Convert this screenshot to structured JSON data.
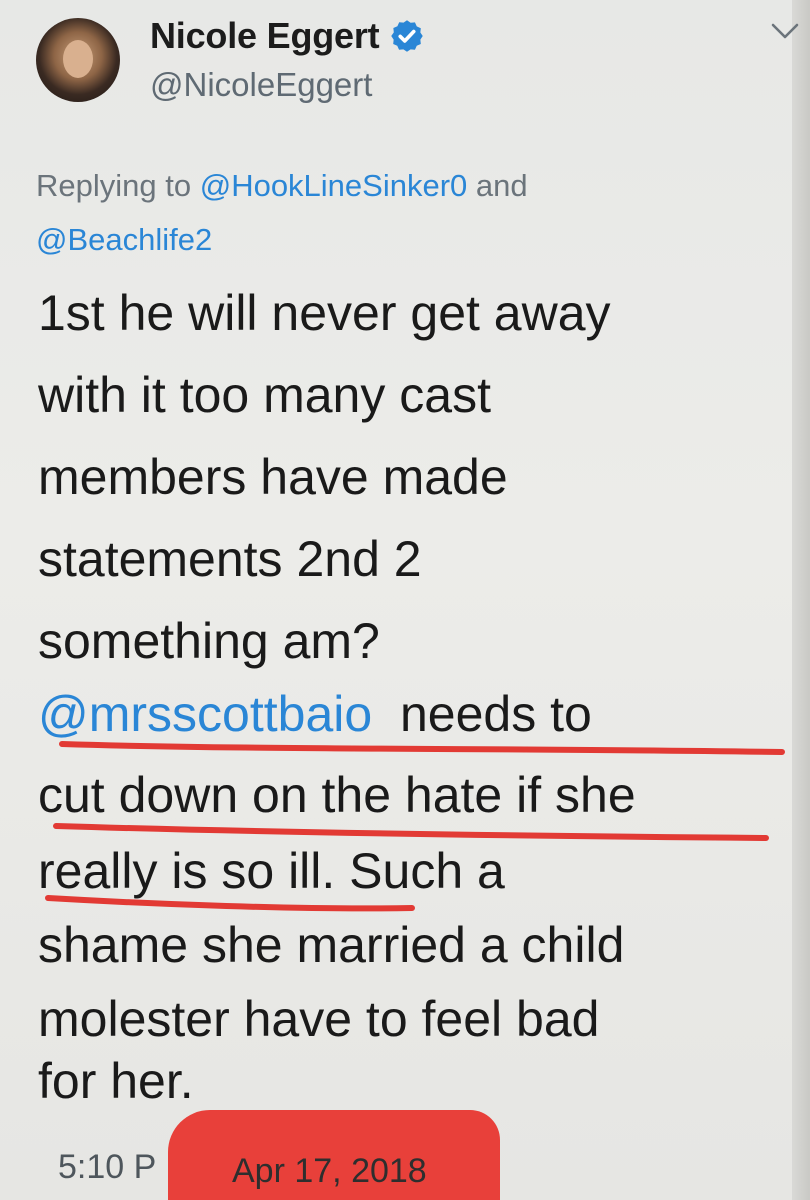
{
  "tweet": {
    "author": {
      "display_name": "Nicole Eggert",
      "handle": "@NicoleEggert",
      "verified_icon": "verified-badge-icon"
    },
    "reply": {
      "prefix": "Replying to ",
      "mention_1": "@HookLineSinker0",
      "joiner": " and",
      "mention_2": "@Beachlife2"
    },
    "body_lines": [
      "1st he will never get away",
      "with it too many cast",
      "members have made",
      "statements 2nd 2",
      "something am?",
      "needs to",
      "cut down on the hate if she",
      "really is so ill. Such a",
      "shame she married a child",
      "molester have to feel bad",
      "for her."
    ],
    "body_mention": "@mrsscottbaio",
    "time_partial": "5:10 P",
    "date": "Apr 17, 2018"
  },
  "colors": {
    "accent": "#2a86d6",
    "underline_red": "#e23a34",
    "redaction_red": "#e8403a"
  }
}
